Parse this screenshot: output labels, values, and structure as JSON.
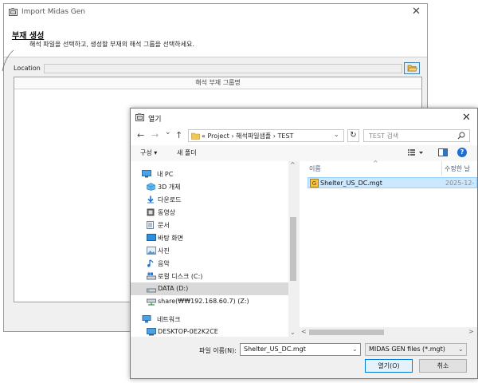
{
  "import_window": {
    "title": "Import Midas Gen",
    "close_glyph": "✕",
    "header_title": "부재 생성",
    "header_subtitle": "해석 파일을 선택하고, 생성할 부재의 해석 그룹을 선택하세요.",
    "location_label": "Location",
    "location_value": "",
    "grid_column_header": "해석 부재 그룹명"
  },
  "open_dialog": {
    "title": "열기",
    "close_glyph": "✕",
    "nav": {
      "back": "←",
      "forward": "→",
      "recent": "⌄",
      "up": "↑",
      "refresh": "↻"
    },
    "breadcrumb": "«  Project  ›  해석파일샘플  ›  TEST",
    "search_placeholder": "TEST 검색",
    "toolbar": {
      "organize": "구성 ▾",
      "new_folder": "새 폴더",
      "help": "?"
    },
    "nav_items": [
      {
        "label": "내 PC",
        "icon": "pc-icon",
        "level": 0
      },
      {
        "label": "3D 개체",
        "icon": "3d-objects-icon",
        "level": 1
      },
      {
        "label": "다운로드",
        "icon": "download-icon",
        "level": 1
      },
      {
        "label": "동영상",
        "icon": "video-icon",
        "level": 1
      },
      {
        "label": "문서",
        "icon": "document-icon",
        "level": 1
      },
      {
        "label": "바탕 화면",
        "icon": "desktop-icon",
        "level": 1
      },
      {
        "label": "사진",
        "icon": "pictures-icon",
        "level": 1
      },
      {
        "label": "음악",
        "icon": "music-icon",
        "level": 1
      },
      {
        "label": "로컬 디스크 (C:)",
        "icon": "local-disk-icon",
        "level": 1
      },
      {
        "label": "DATA (D:)",
        "icon": "drive-icon",
        "level": 1,
        "selected": true
      },
      {
        "label": "share(₩₩192.168.60.7) (Z:)",
        "icon": "network-drive-icon",
        "level": 1
      },
      {
        "label": "네트워크",
        "icon": "network-icon",
        "level": 0
      },
      {
        "label": "DESKTOP-0E2K2CE",
        "icon": "computer-icon",
        "level": 1
      }
    ],
    "columns": {
      "name": "이름",
      "date": "수정한 날"
    },
    "files": [
      {
        "name": "Shelter_US_DC.mgt",
        "date": "2025-12-",
        "selected": true
      }
    ],
    "filename_label": "파일 이름(N):",
    "filename_value": "Shelter_US_DC.mgt",
    "filter_value": "MIDAS GEN files (*.mgt)",
    "open_button": "열기(O)",
    "cancel_button": "취소"
  },
  "colors": {
    "accent": "#0078d7",
    "selection": "#cce8ff",
    "nav_selected": "#d9d9d9"
  }
}
